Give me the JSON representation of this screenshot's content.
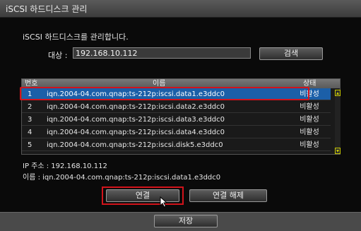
{
  "window": {
    "title": "iSCSI 하드디스크 관리"
  },
  "description": "iSCSI 하드디스크를 관리합니다.",
  "target": {
    "label": "대상 :",
    "value": "192.168.10.112"
  },
  "search_button": "검색",
  "table": {
    "headers": {
      "no": "번호",
      "name": "이름",
      "status": "상태"
    },
    "rows": [
      {
        "no": "1",
        "name": "iqn.2004-04.com.qnap:ts-212p:iscsi.data1.e3ddc0",
        "status": "비활성",
        "selected": true
      },
      {
        "no": "2",
        "name": "iqn.2004-04.com.qnap:ts-212p:iscsi.data2.e3ddc0",
        "status": "비활성",
        "selected": false
      },
      {
        "no": "3",
        "name": "iqn.2004-04.com.qnap:ts-212p:iscsi.data3.e3ddc0",
        "status": "비활성",
        "selected": false
      },
      {
        "no": "4",
        "name": "iqn.2004-04.com.qnap:ts-212p:iscsi.data4.e3ddc0",
        "status": "비활성",
        "selected": false
      },
      {
        "no": "5",
        "name": "iqn.2004-04.com.qnap:ts-212p:iscsi.disk5.e3ddc0",
        "status": "비활성",
        "selected": false
      }
    ]
  },
  "info": {
    "ip": "IP 주소 : 192.168.10.112",
    "name": "이름 : iqn.2004-04.com.qnap:ts-212p:iscsi.data1.e3ddc0"
  },
  "buttons": {
    "connect": "연결",
    "disconnect": "연결 해제",
    "save": "저장"
  },
  "colors": {
    "selection": "#1b5fa8",
    "highlight": "#d2131b",
    "scroll_arrow": "#c8c800"
  }
}
